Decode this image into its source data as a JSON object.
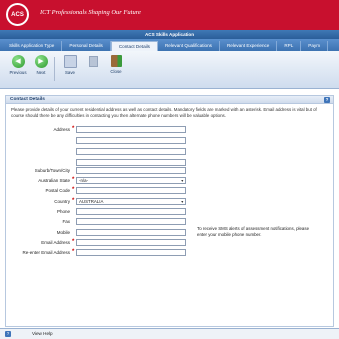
{
  "header": {
    "logo_text": "ACS",
    "tagline": "ICT Professionals Shaping Our Future"
  },
  "app_title": "ACS Skills Application",
  "tabs": [
    {
      "label": "Skills Application Type"
    },
    {
      "label": "Personal Details"
    },
    {
      "label": "Contact Details",
      "active": true
    },
    {
      "label": "Relevant Qualifications"
    },
    {
      "label": "Relevant Experience"
    },
    {
      "label": "RPL"
    },
    {
      "label": "Paym"
    }
  ],
  "toolbar": {
    "previous": "Previous",
    "next": "Next",
    "save": "Save",
    "close": "Close",
    "previous_icon": "arrow-left-icon",
    "next_icon": "arrow-right-icon",
    "save_icon": "disk-icon",
    "close_icon": "exit-door-icon"
  },
  "section": {
    "title": "Contact Details",
    "help_glyph": "?",
    "intro": "Please provide details of your current residential address as well as contact details. Mandatory fields are marked with an asterisk. Email address is vital but of course should there be any difficulties in contacting you then alternate phone numbers will be valuable options."
  },
  "form": {
    "address_label": "Address",
    "suburb_label": "Suburb/Town/City",
    "state_label": "Australian State",
    "state_value": "-n/a-",
    "postcode_label": "Postal Code",
    "country_label": "Country",
    "country_value": "AUSTRALIA",
    "phone_label": "Phone",
    "fax_label": "Fax",
    "mobile_label": "Mobile",
    "email_label": "Email Address",
    "reemail_label": "Re-enter Email Address",
    "required_mark": "*",
    "mobile_note": "To receive SMS alerts of assessment notifications, please enter your mobile phone number."
  },
  "footer": {
    "help_glyph": "?",
    "view_help": "View Help"
  },
  "colors": {
    "brand_red": "#c8102e",
    "accent_blue": "#3c72b1",
    "required_red": "#cc0000"
  }
}
